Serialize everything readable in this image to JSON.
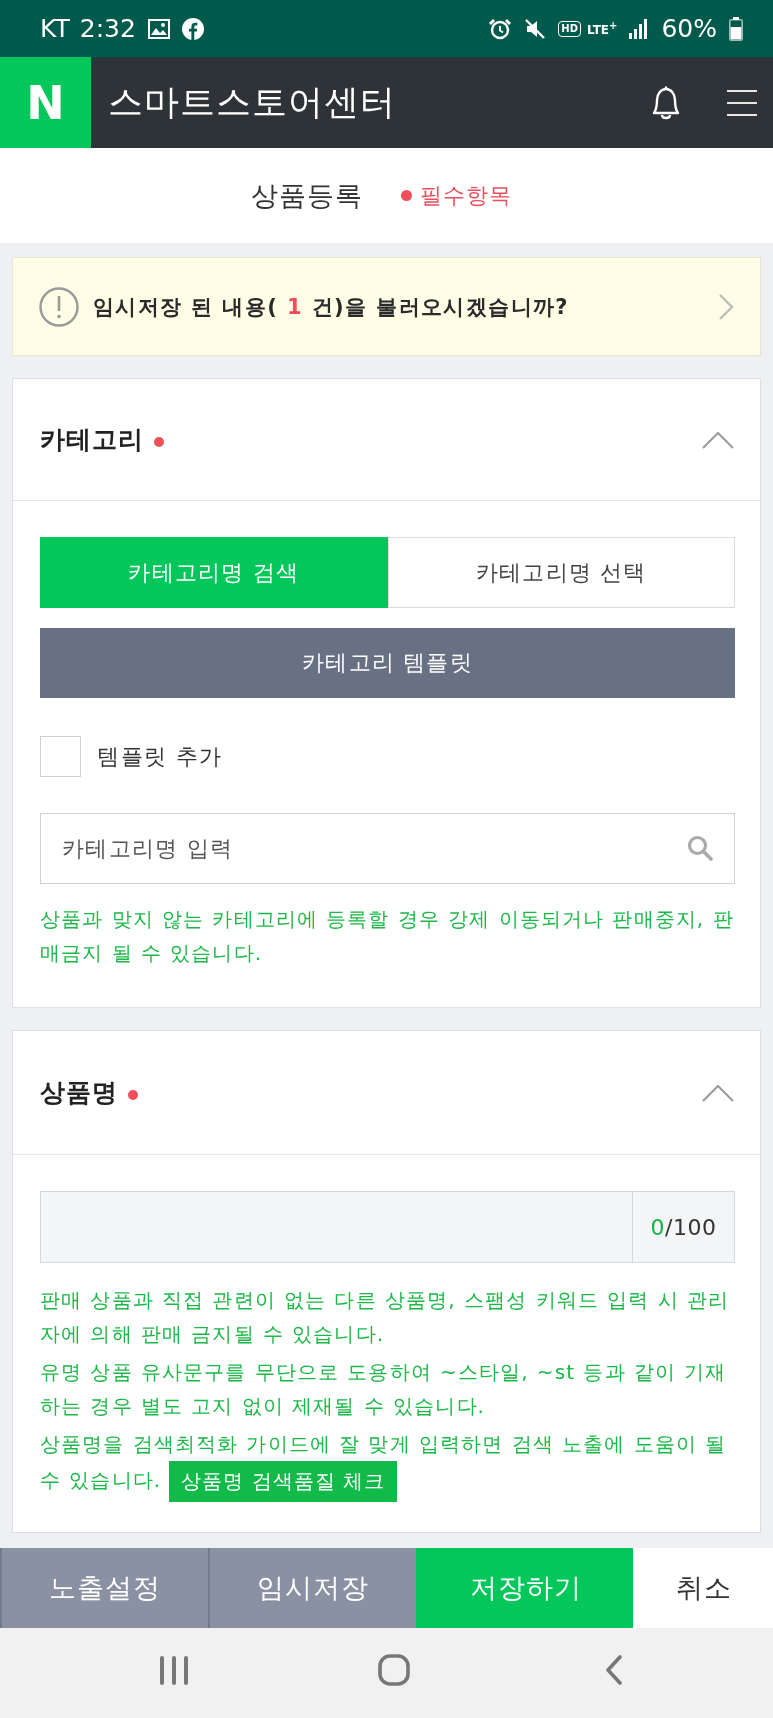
{
  "status_bar": {
    "carrier": "KT",
    "time": "2:32",
    "hd_label": "HD",
    "network_label": "LTE$^{+}$",
    "battery_percent": "60%"
  },
  "app_header": {
    "logo": "N",
    "title": "스마트스토어센터"
  },
  "page_header": {
    "title": "상품등록",
    "required_legend": "필수항목"
  },
  "draft_notice": {
    "text_before": "임시저장 된 내용( ",
    "count": "1",
    "text_after": " 건)을 불러오시겠습니까?"
  },
  "sections": [
    {
      "kind": "category",
      "title": "카테고리",
      "required": true,
      "expanded": true,
      "tabs": [
        {
          "label": "카테고리명 검색",
          "selected": true
        },
        {
          "label": "카테고리명 선택",
          "selected": false
        }
      ],
      "template_button": "카테고리 템플릿",
      "template_checkbox": {
        "label": "템플릿 추가",
        "checked": false
      },
      "search": {
        "placeholder": "카테고리명 입력"
      },
      "notes": [
        "상품과 맞지 않는 카테고리에 등록할 경우 강제 이동되거나 판매중지, 판매금지 될 수 있습니다."
      ]
    },
    {
      "kind": "product_name",
      "title": "상품명",
      "required": true,
      "expanded": true,
      "counter": {
        "current": "0",
        "limit": "/100"
      },
      "notes": [
        "판매 상품과 직접 관련이 없는 다른 상품명, 스팸성 키워드 입력 시 관리자에 의해 판매 금지될 수 있습니다.",
        "유명 상품 유사문구를 무단으로 도용하여 ~스타일, ~st 등과 같이 기재하는 경우 별도 고지 없이 제재될 수 있습니다.",
        "상품명을 검색최적화 가이드에 잘 맞게 입력하면 검색 노출에 도움이 될 수 있습니다."
      ],
      "check_button": "상품명 검색품질 체크"
    }
  ],
  "footer_actions": [
    {
      "label": "노출설정",
      "kind": "secondary"
    },
    {
      "label": "임시저장",
      "kind": "secondary"
    },
    {
      "label": "저장하기",
      "kind": "primary"
    },
    {
      "label": "취소",
      "kind": "plain"
    }
  ]
}
